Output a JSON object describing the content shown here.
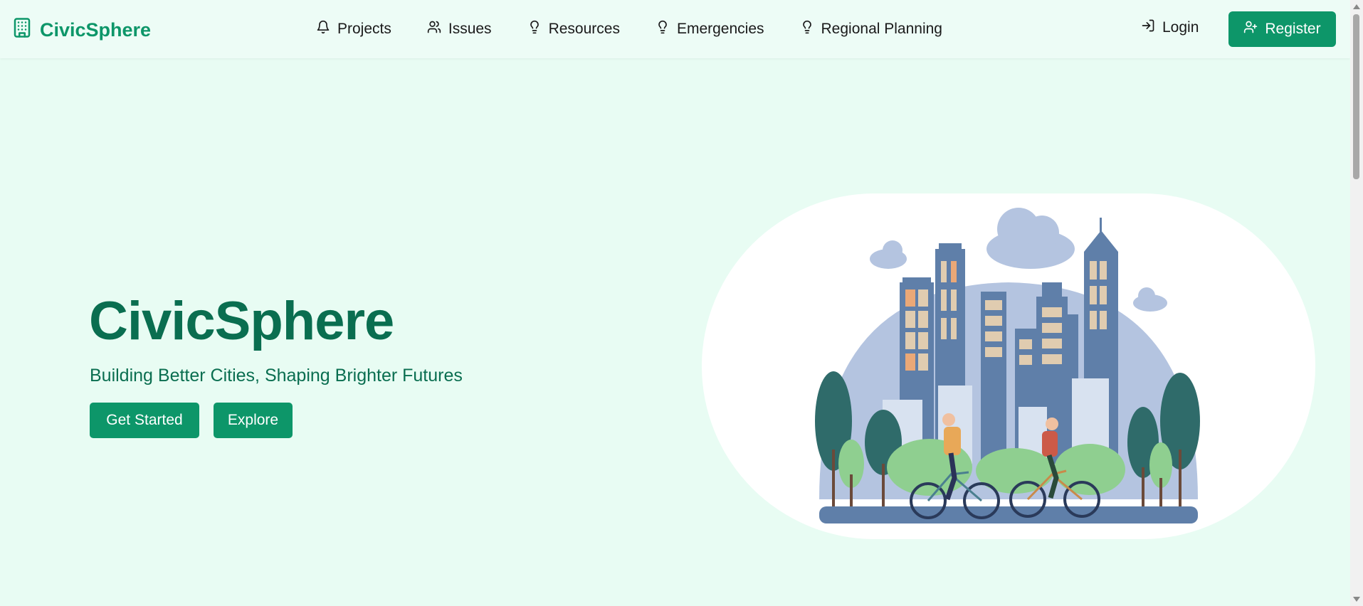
{
  "brand": {
    "name": "CivicSphere",
    "icon": "building-icon",
    "color": "#0d9669"
  },
  "nav": {
    "links": [
      {
        "label": "Projects",
        "icon": "bell-icon"
      },
      {
        "label": "Issues",
        "icon": "users-icon"
      },
      {
        "label": "Resources",
        "icon": "lightbulb-icon"
      },
      {
        "label": "Emergencies",
        "icon": "lightbulb-icon"
      },
      {
        "label": "Regional Planning",
        "icon": "lightbulb-icon"
      }
    ],
    "login_label": "Login",
    "register_label": "Register"
  },
  "hero": {
    "title": "CivicSphere",
    "subtitle": "Building Better Cities, Shaping Brighter Futures",
    "primary_button": "Get Started",
    "secondary_button": "Explore",
    "title_color": "#0a6e50"
  },
  "colors": {
    "background": "#e8fcf3",
    "accent": "#0d9669"
  }
}
